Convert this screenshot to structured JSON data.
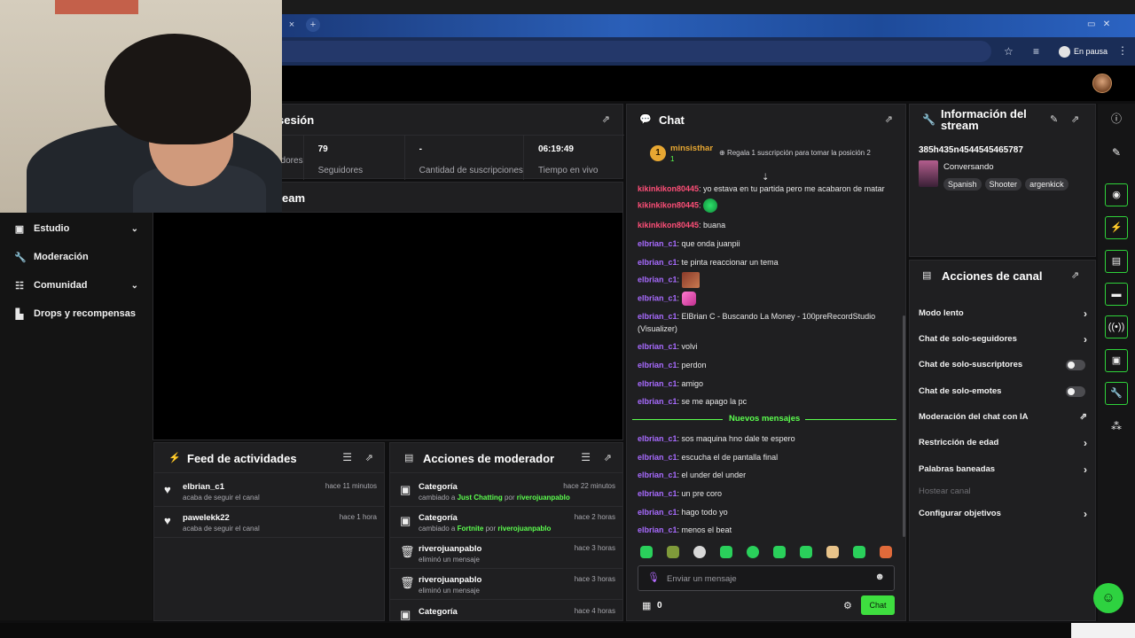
{
  "browser": {
    "new_tab": "+",
    "close_tab": "×",
    "profile_status": "En pausa",
    "icons": [
      "star-icon",
      "media-icon",
      "menu-icon"
    ]
  },
  "nav": {
    "items": [
      {
        "label": "Estudio",
        "icon": "studio-icon",
        "has_chevron": true
      },
      {
        "label": "Moderación",
        "icon": "wrench-icon",
        "has_chevron": false
      },
      {
        "label": "Comunidad",
        "icon": "community-icon",
        "has_chevron": true
      },
      {
        "label": "Drops y recompensas",
        "icon": "drops-icon",
        "has_chevron": false
      }
    ]
  },
  "session": {
    "title_partial": "sesión",
    "stats": [
      {
        "value": "",
        "label": "adores"
      },
      {
        "value": "79",
        "label": "Seguidores"
      },
      {
        "value": "-",
        "label": "Cantidad de suscripciones"
      },
      {
        "value": "06:19:49",
        "label": "Tiempo en vivo"
      }
    ]
  },
  "stream_preview": {
    "title_partial": "ream"
  },
  "feed": {
    "title": "Feed de actividades",
    "items": [
      {
        "user": "elbrian_c1",
        "action": "acaba de seguir el canal",
        "time": "hace 11 minutos"
      },
      {
        "user": "pawelekk22",
        "action": "acaba de seguir el canal",
        "time": "hace 1 hora"
      }
    ]
  },
  "mod_actions": {
    "title": "Acciones de moderador",
    "items": [
      {
        "title": "Categoría",
        "pre": "cambiado a",
        "target": "Just Chatting",
        "by_word": "por",
        "by": "riverojuanpablo",
        "time": "hace 22 minutos",
        "icon": "category-icon"
      },
      {
        "title": "Categoría",
        "pre": "cambiado a",
        "target": "Fortnite",
        "by_word": "por",
        "by": "riverojuanpablo",
        "time": "hace 2 horas",
        "icon": "category-icon"
      },
      {
        "title": "riverojuanpablo",
        "pre": "eliminó un mensaje",
        "target": "",
        "by_word": "",
        "by": "",
        "time": "hace 3 horas",
        "icon": "trash-icon"
      },
      {
        "title": "riverojuanpablo",
        "pre": "eliminó un mensaje",
        "target": "",
        "by_word": "",
        "by": "",
        "time": "hace 3 horas",
        "icon": "trash-icon"
      },
      {
        "title": "Categoría",
        "pre": "",
        "target": "",
        "by_word": "",
        "by": "",
        "time": "hace 4 horas",
        "icon": "category-icon"
      }
    ]
  },
  "chat": {
    "title": "Chat",
    "pinned": {
      "rank": "1",
      "user": "minsisthar",
      "count": "1",
      "message": "Regala 1 suscripción para tomar la posición 2"
    },
    "messages": [
      {
        "user": "kikinkikon80445",
        "color": "pink",
        "text": ": yo estava en tu partida pero me acabaron de matar",
        "emote": ""
      },
      {
        "user": "kikinkikon80445",
        "color": "pink",
        "text": ": ",
        "emote": "green-face-emote"
      },
      {
        "user": "kikinkikon80445",
        "color": "pink",
        "text": ": buana",
        "emote": ""
      },
      {
        "user": "elbrian_c1",
        "color": "purple",
        "text": ": que onda juanpii",
        "emote": ""
      },
      {
        "user": "elbrian_c1",
        "color": "purple",
        "text": ": te pinta reaccionar un tema",
        "emote": ""
      },
      {
        "user": "elbrian_c1",
        "color": "purple",
        "text": ": ",
        "emote": "photo-emote"
      },
      {
        "user": "elbrian_c1",
        "color": "purple",
        "text": ": ",
        "emote": "pink-hand-emote"
      },
      {
        "user": "elbrian_c1",
        "color": "purple",
        "text": ": ElBrian C - Buscando La Money - 100preRecordStudio (Visualizer)",
        "emote": ""
      },
      {
        "user": "elbrian_c1",
        "color": "purple",
        "text": ": volvi",
        "emote": ""
      },
      {
        "user": "elbrian_c1",
        "color": "purple",
        "text": ": perdon",
        "emote": ""
      },
      {
        "user": "elbrian_c1",
        "color": "purple",
        "text": ": amigo",
        "emote": ""
      },
      {
        "user": "elbrian_c1",
        "color": "purple",
        "text": ": se me apago la pc",
        "emote": ""
      }
    ],
    "new_messages_label": "Nuevos mensajes",
    "new_messages": [
      {
        "user": "elbrian_c1",
        "text": ": sos maquina hno dale te espero"
      },
      {
        "user": "elbrian_c1",
        "text": ": escucha el de pantalla final"
      },
      {
        "user": "elbrian_c1",
        "text": ": el under del under"
      },
      {
        "user": "elbrian_c1",
        "text": ": un pre coro"
      },
      {
        "user": "elbrian_c1",
        "text": ": hago todo yo"
      },
      {
        "user": "elbrian_c1",
        "text": ": menos el beat"
      }
    ],
    "input_placeholder": "Enviar un mensaje",
    "points": "0",
    "send_label": "Chat"
  },
  "stream_info": {
    "title": "Información del stream",
    "stream_title": "385h435n4544545465787",
    "category": "Conversando",
    "tags": [
      "Spanish",
      "Shooter",
      "argenkick"
    ]
  },
  "channel_actions": {
    "title": "Acciones de canal",
    "items": [
      {
        "label": "Modo lento",
        "control": "chevron"
      },
      {
        "label": "Chat de solo-seguidores",
        "control": "chevron"
      },
      {
        "label": "Chat de solo-suscriptores",
        "control": "toggle",
        "on": false
      },
      {
        "label": "Chat de solo-emotes",
        "control": "toggle",
        "on": false
      },
      {
        "label": "Moderación del chat con IA",
        "control": "external"
      },
      {
        "label": "Restricción de edad",
        "control": "chevron"
      },
      {
        "label": "Palabras baneadas",
        "control": "chevron"
      },
      {
        "label": "Hostear canal",
        "control": "none",
        "disabled": true
      },
      {
        "label": "Configurar objetivos",
        "control": "chevron"
      }
    ]
  },
  "colors": {
    "accent": "#3ede3f",
    "panel": "#1f1f21",
    "pink_user": "#ff4f78",
    "purple_user": "#a86bff"
  }
}
